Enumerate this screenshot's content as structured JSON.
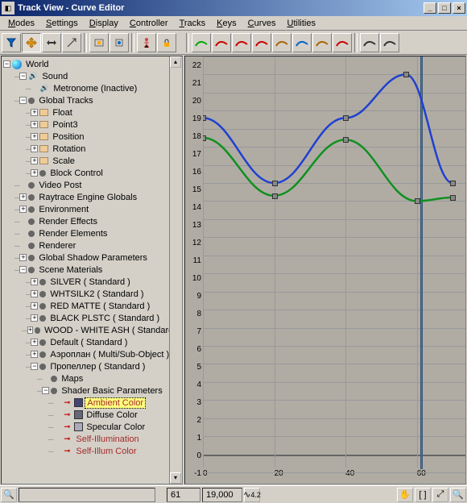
{
  "window": {
    "title": "Track View - Curve Editor"
  },
  "menu": [
    "Modes",
    "Settings",
    "Display",
    "Controller",
    "Tracks",
    "Keys",
    "Curves",
    "Utilities"
  ],
  "toolbar_left_icons": [
    "filter-icon",
    "move-icon",
    "slide-icon",
    "scale-icon",
    "sep",
    "snap-frame-icon",
    "snap-icon",
    "sep",
    "biped-icon",
    "lock-icon"
  ],
  "toolbar_right_icons": [
    "tangent-auto-icon",
    "tangent-in-icon",
    "tangent-out-icon",
    "tangent-fast-icon",
    "tangent-slow-icon",
    "tangent-step-icon",
    "tangent-linear-icon",
    "tangent-smooth-icon",
    "sep",
    "lock-tangent-icon",
    "lock-selection-icon"
  ],
  "tree": [
    {
      "d": 0,
      "t": "-",
      "i": "globe",
      "l": "World"
    },
    {
      "d": 1,
      "t": "-",
      "i": "snd",
      "l": "Sound"
    },
    {
      "d": 2,
      "t": "",
      "i": "snd",
      "l": "Metronome (Inactive)"
    },
    {
      "d": 1,
      "t": "-",
      "i": "topic",
      "l": "Global Tracks"
    },
    {
      "d": 2,
      "t": "+",
      "i": "track",
      "l": "Float"
    },
    {
      "d": 2,
      "t": "+",
      "i": "track",
      "l": "Point3"
    },
    {
      "d": 2,
      "t": "+",
      "i": "track",
      "l": "Position"
    },
    {
      "d": 2,
      "t": "+",
      "i": "track",
      "l": "Rotation"
    },
    {
      "d": 2,
      "t": "+",
      "i": "track",
      "l": "Scale"
    },
    {
      "d": 2,
      "t": "+",
      "i": "topic",
      "l": "Block Control"
    },
    {
      "d": 1,
      "t": "",
      "i": "topic",
      "l": "Video Post"
    },
    {
      "d": 1,
      "t": "+",
      "i": "topic",
      "l": "Raytrace Engine Globals"
    },
    {
      "d": 1,
      "t": "+",
      "i": "topic",
      "l": "Environment"
    },
    {
      "d": 1,
      "t": "",
      "i": "topic",
      "l": "Render Effects"
    },
    {
      "d": 1,
      "t": "",
      "i": "topic",
      "l": "Render Elements"
    },
    {
      "d": 1,
      "t": "",
      "i": "topic",
      "l": "Renderer"
    },
    {
      "d": 1,
      "t": "+",
      "i": "topic",
      "l": "Global Shadow Parameters"
    },
    {
      "d": 1,
      "t": "-",
      "i": "topic",
      "l": "Scene Materials"
    },
    {
      "d": 2,
      "t": "+",
      "i": "topic",
      "l": "SILVER  ( Standard )"
    },
    {
      "d": 2,
      "t": "+",
      "i": "topic",
      "l": "WHTSILK2  ( Standard )"
    },
    {
      "d": 2,
      "t": "+",
      "i": "topic",
      "l": "RED MATTE  ( Standard )"
    },
    {
      "d": 2,
      "t": "+",
      "i": "topic",
      "l": "BLACK PLSTC  ( Standard )"
    },
    {
      "d": 2,
      "t": "+",
      "i": "topic",
      "l": "WOOD - WHITE ASH  ( Standard )"
    },
    {
      "d": 2,
      "t": "+",
      "i": "topic",
      "l": "Default  ( Standard )"
    },
    {
      "d": 2,
      "t": "+",
      "i": "topic",
      "l": "Аэроплан  ( Multi/Sub-Object )"
    },
    {
      "d": 2,
      "t": "-",
      "i": "topic",
      "l": "Пропеллер  ( Standard )"
    },
    {
      "d": 3,
      "t": "",
      "i": "topic",
      "l": "Maps"
    },
    {
      "d": 3,
      "t": "-",
      "i": "topic",
      "l": "Shader Basic Parameters"
    },
    {
      "d": 4,
      "t": "",
      "i": "key",
      "l": "Ambient Color",
      "sel": true,
      "sw": "#447"
    },
    {
      "d": 4,
      "t": "",
      "i": "key",
      "l": "Diffuse Color",
      "sw": "#667"
    },
    {
      "d": 4,
      "t": "",
      "i": "key",
      "l": "Specular Color",
      "sw": "#aab"
    },
    {
      "d": 4,
      "t": "",
      "i": "key",
      "l": "Self-Illumination",
      "red": true
    },
    {
      "d": 4,
      "t": "",
      "i": "key",
      "l": "Self-Illum Color",
      "red": true
    }
  ],
  "chart_data": {
    "type": "line",
    "x_ticks": [
      0,
      20,
      40,
      60
    ],
    "y_ticks": [
      22,
      21,
      20,
      19,
      18,
      17,
      16,
      15,
      14,
      13,
      12,
      11,
      10,
      9,
      8,
      7,
      6,
      5,
      4,
      3,
      2,
      1,
      0,
      -1
    ],
    "xlim": [
      0,
      70
    ],
    "ylim": [
      -1,
      22
    ],
    "playhead": 61,
    "series": [
      {
        "name": "blue",
        "color": "#2040d0",
        "keys": [
          {
            "x": 0,
            "y": 18.6
          },
          {
            "x": 20,
            "y": 15.0
          },
          {
            "x": 40,
            "y": 18.6
          },
          {
            "x": 57,
            "y": 21.0
          },
          {
            "x": 70,
            "y": 15.0
          }
        ]
      },
      {
        "name": "green",
        "color": "#109020",
        "keys": [
          {
            "x": 0,
            "y": 17.5
          },
          {
            "x": 20,
            "y": 14.3
          },
          {
            "x": 40,
            "y": 17.4
          },
          {
            "x": 60,
            "y": 14.0
          },
          {
            "x": 70,
            "y": 14.2
          }
        ]
      }
    ]
  },
  "status": {
    "frame": "61",
    "value": "19,000",
    "zoom": "4.2"
  }
}
